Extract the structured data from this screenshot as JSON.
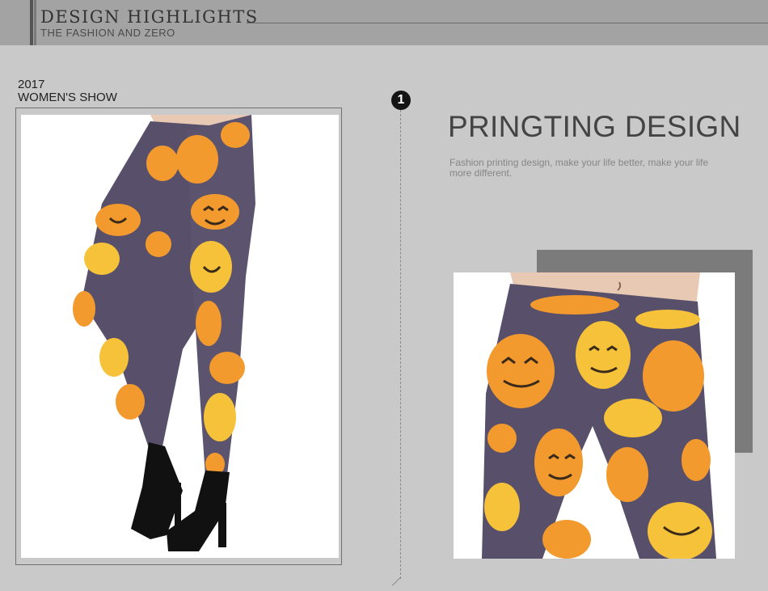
{
  "header": {
    "title": "DESIGN  HIGHLIGHTS",
    "subtitle": "THE FASHION AND ZERO"
  },
  "show": {
    "year": "2017",
    "label": "WOMEN'S SHOW"
  },
  "step": {
    "number": "1"
  },
  "feature": {
    "title": "PRINGTING DESIGN",
    "description": "Fashion printing design, make your life better, make your life more different."
  },
  "images": {
    "left": "leggings-full-view-photo",
    "right": "leggings-closeup-photo"
  },
  "colors": {
    "header_band": "#a3a3a3",
    "background": "#c9c9c9",
    "legging_base": "#58506a",
    "pumpkin": "#f39a2e",
    "pumpkin_yellow": "#f5c23a",
    "shoe": "#111111"
  }
}
